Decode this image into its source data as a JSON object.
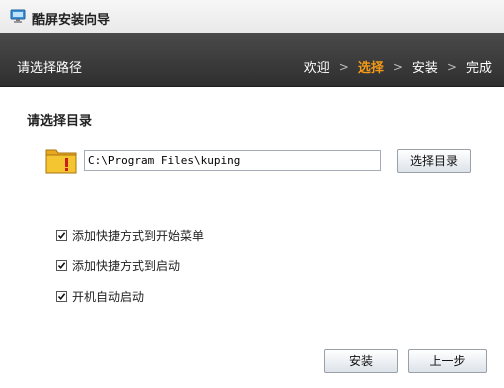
{
  "window": {
    "title": "酷屏安装向导"
  },
  "header": {
    "title": "请选择路径",
    "steps": [
      {
        "label": "欢迎",
        "active": false
      },
      {
        "label": "选择",
        "active": true
      },
      {
        "label": "安装",
        "active": false
      },
      {
        "label": "完成",
        "active": false
      }
    ]
  },
  "main": {
    "section_title": "请选择目录",
    "install_path": "C:\\Program Files\\kuping",
    "browse_label": "选择目录",
    "options": [
      {
        "label": "添加快捷方式到开始菜单",
        "checked": true
      },
      {
        "label": "添加快捷方式到启动",
        "checked": true
      },
      {
        "label": "开机自动启动",
        "checked": true
      }
    ]
  },
  "footer": {
    "install_label": "安装",
    "back_label": "上一步"
  },
  "colors": {
    "accent": "#f39a16",
    "header_bg": "#3a3a3a"
  }
}
